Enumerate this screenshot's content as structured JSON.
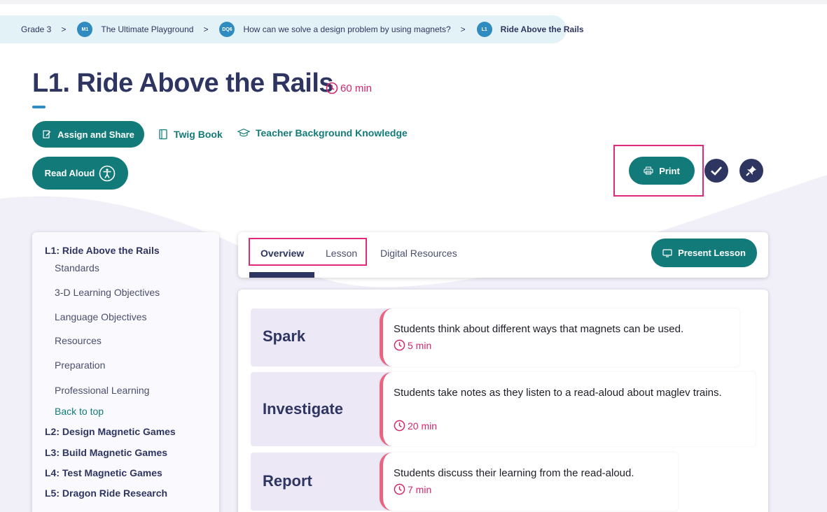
{
  "breadcrumb": {
    "grade": "Grade 3",
    "module_badge": "M1",
    "module": "The Ultimate Playground",
    "dq_badge": "DQ6",
    "dq": "How can we solve a design problem by using magnets?",
    "lesson_badge": "L1",
    "lesson": "Ride Above the Rails",
    "separator": ">"
  },
  "lesson": {
    "title": "L1. Ride Above the Rails",
    "duration": "60 min"
  },
  "actions": {
    "assign_share": "Assign and Share",
    "twig_book": "Twig Book",
    "teacher_background": "Teacher Background Knowledge",
    "read_aloud": "Read Aloud",
    "print": "Print"
  },
  "icons": {
    "clock": "clock-icon",
    "assign": "assign-icon",
    "book": "book-icon",
    "graduation_cap": "graduation-cap-icon",
    "accessibility": "accessibility-icon",
    "printer": "printer-icon",
    "check": "check-icon",
    "pin": "pin-icon",
    "present": "present-icon"
  },
  "sidebar": {
    "current_lesson": "L1: Ride Above the Rails",
    "sections": [
      "Standards",
      "3-D Learning Objectives",
      "Language Objectives",
      "Resources",
      "Preparation",
      "Professional Learning"
    ],
    "back_to_top": "Back to top",
    "other_lessons": [
      "L2: Design Magnetic Games",
      "L3: Build Magnetic Games",
      "L4: Test Magnetic Games",
      "L5: Dragon Ride Research"
    ]
  },
  "tabs": {
    "overview": "Overview",
    "lesson": "Lesson",
    "digital_resources": "Digital Resources",
    "present_lesson": "Present Lesson"
  },
  "phases": [
    {
      "name": "Spark",
      "description": "Students think about different ways that magnets can be used.",
      "time": "5 min"
    },
    {
      "name": "Investigate",
      "description": "Students take notes as they listen to a read-aloud about maglev trains.",
      "time": "20 min"
    },
    {
      "name": "Report",
      "description": "Students discuss their learning from the read-aloud.",
      "time": "7 min"
    }
  ],
  "colors": {
    "navy": "#2e3561",
    "teal": "#127b79",
    "magenta": "#d4266d",
    "highlight": "#e0297a",
    "phase_bg": "#ece8f5",
    "phase_accent": "#e8647f"
  }
}
